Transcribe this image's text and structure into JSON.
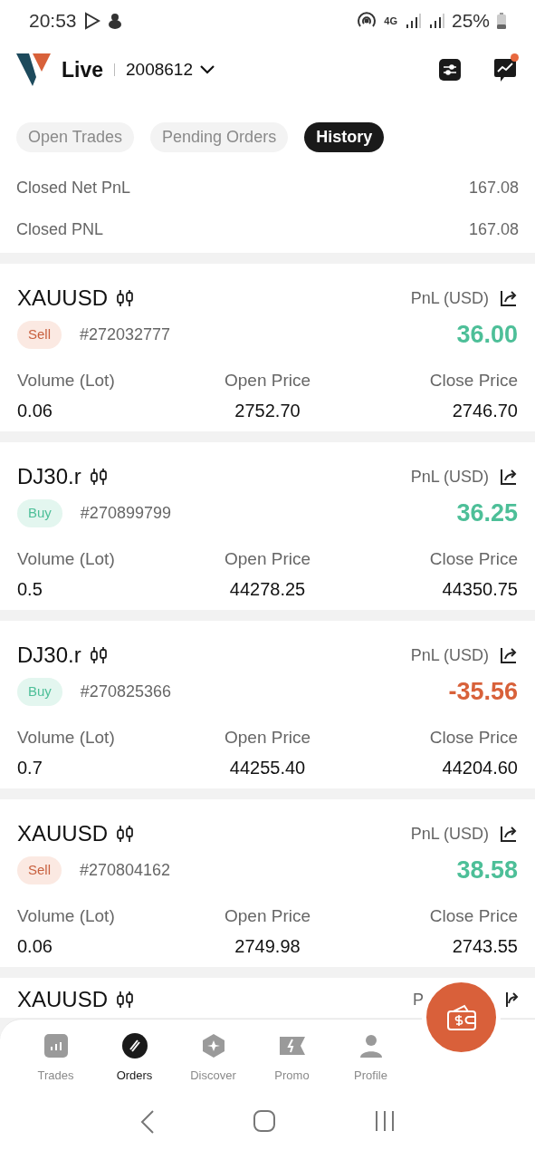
{
  "status_bar": {
    "time": "20:53",
    "network": "4G",
    "battery": "25%"
  },
  "header": {
    "mode": "Live",
    "account": "2008612",
    "notification": true
  },
  "tabs": [
    {
      "label": "Open Trades",
      "selected": false
    },
    {
      "label": "Pending Orders",
      "selected": false
    },
    {
      "label": "History",
      "selected": true
    }
  ],
  "summary": [
    {
      "label": "Closed Net PnL",
      "value": "167.08"
    },
    {
      "label": "Closed PNL",
      "value": "167.08"
    }
  ],
  "trades": [
    {
      "symbol": "XAUUSD",
      "side": "Sell",
      "ticket": "#272032777",
      "pnl_label": "PnL (USD)",
      "pnl": "36.00",
      "profit": true,
      "volume_label": "Volume (Lot)",
      "volume": "0.06",
      "open_label": "Open Price",
      "open": "2752.70",
      "close_label": "Close Price",
      "close": "2746.70"
    },
    {
      "symbol": "DJ30.r",
      "side": "Buy",
      "ticket": "#270899799",
      "pnl_label": "PnL (USD)",
      "pnl": "36.25",
      "profit": true,
      "volume_label": "Volume (Lot)",
      "volume": "0.5",
      "open_label": "Open Price",
      "open": "44278.25",
      "close_label": "Close Price",
      "close": "44350.75"
    },
    {
      "symbol": "DJ30.r",
      "side": "Buy",
      "ticket": "#270825366",
      "pnl_label": "PnL (USD)",
      "pnl": "-35.56",
      "profit": false,
      "volume_label": "Volume (Lot)",
      "volume": "0.7",
      "open_label": "Open Price",
      "open": "44255.40",
      "close_label": "Close Price",
      "close": "44204.60"
    },
    {
      "symbol": "XAUUSD",
      "side": "Sell",
      "ticket": "#270804162",
      "pnl_label": "PnL (USD)",
      "pnl": "38.58",
      "profit": true,
      "volume_label": "Volume (Lot)",
      "volume": "0.06",
      "open_label": "Open Price",
      "open": "2749.98",
      "close_label": "Close Price",
      "close": "2743.55"
    }
  ],
  "partial_trade": {
    "symbol": "XAUUSD",
    "pnl_label": "P"
  },
  "bottom_nav": [
    {
      "label": "Trades",
      "kind": "trades",
      "selected": false
    },
    {
      "label": "Orders",
      "kind": "orders",
      "selected": true
    },
    {
      "label": "Discover",
      "kind": "discover",
      "selected": false
    },
    {
      "label": "Promo",
      "kind": "promo",
      "selected": false
    },
    {
      "label": "Profile",
      "kind": "profile",
      "selected": false
    }
  ]
}
